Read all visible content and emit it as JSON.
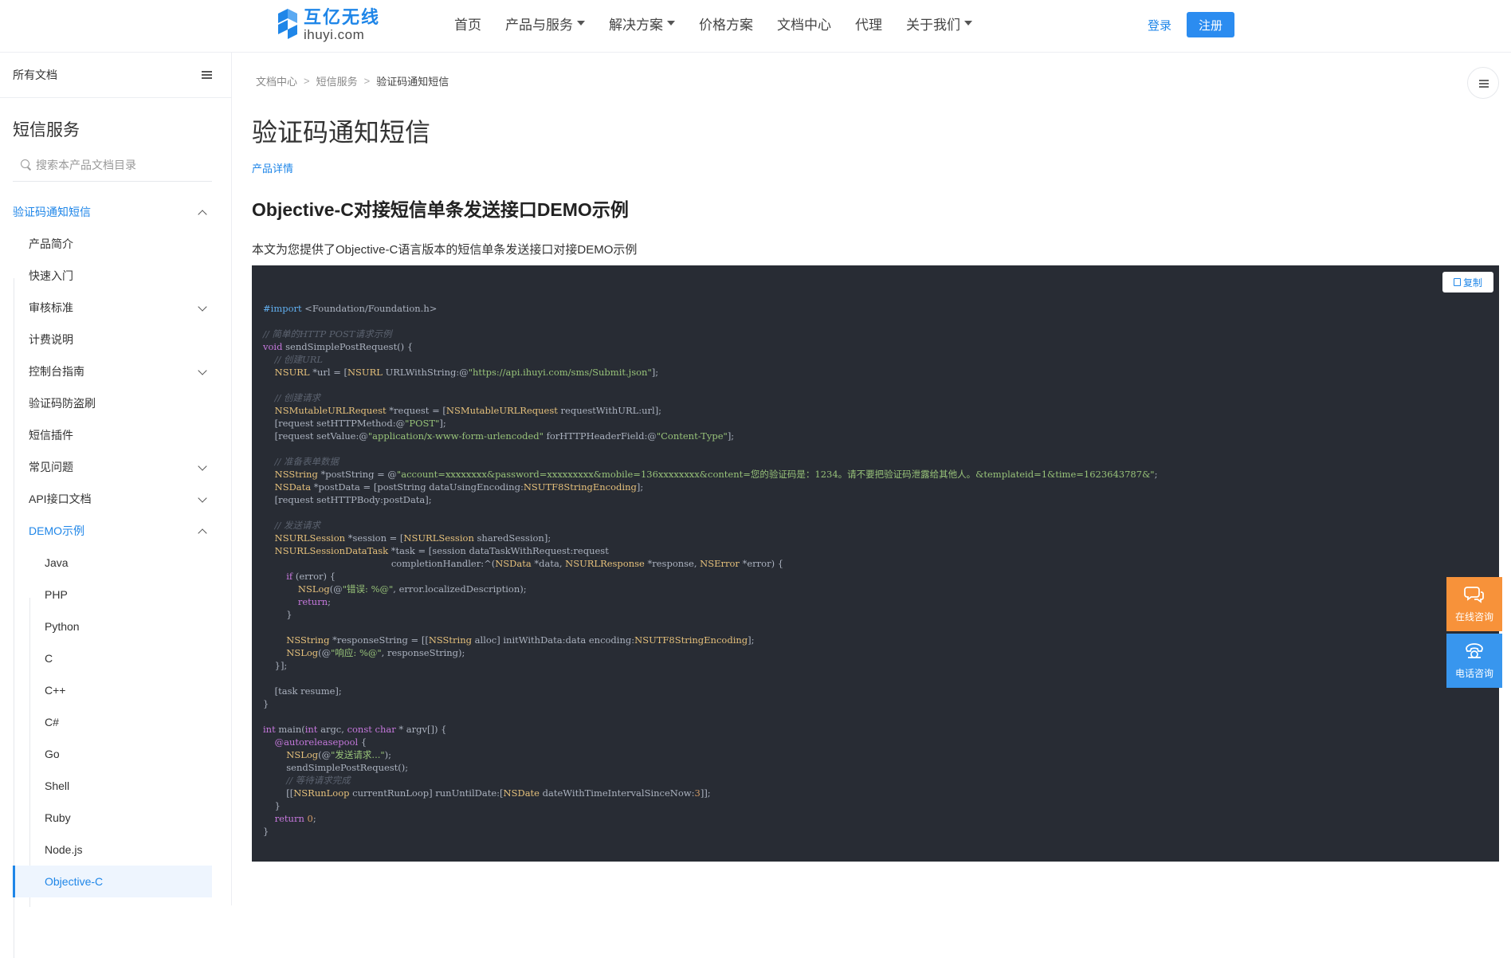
{
  "brand": {
    "name_cn": "互亿无线",
    "name_en": "ihuyi.com",
    "color": "#1f86e8"
  },
  "nav": {
    "items": [
      {
        "label": "首页",
        "dropdown": false
      },
      {
        "label": "产品与服务",
        "dropdown": true
      },
      {
        "label": "解决方案",
        "dropdown": true
      },
      {
        "label": "价格方案",
        "dropdown": false
      },
      {
        "label": "文档中心",
        "dropdown": false
      },
      {
        "label": "代理",
        "dropdown": false
      },
      {
        "label": "关于我们",
        "dropdown": true
      }
    ],
    "login": "登录",
    "register": "注册"
  },
  "sidebar": {
    "all_docs": "所有文档",
    "section_title": "短信服务",
    "search_placeholder": "搜索本产品文档目录",
    "tree": [
      {
        "label": "验证码通知短信",
        "level": 0,
        "expand": "up"
      },
      {
        "label": "产品简介",
        "level": 1
      },
      {
        "label": "快速入门",
        "level": 1
      },
      {
        "label": "审核标准",
        "level": 1,
        "expand": "down"
      },
      {
        "label": "计费说明",
        "level": 1
      },
      {
        "label": "控制台指南",
        "level": 1,
        "expand": "down"
      },
      {
        "label": "验证码防盗刷",
        "level": 1
      },
      {
        "label": "短信插件",
        "level": 1
      },
      {
        "label": "常见问题",
        "level": 1,
        "expand": "down"
      },
      {
        "label": "API接口文档",
        "level": 1,
        "expand": "down"
      },
      {
        "label": "DEMO示例",
        "level": 1,
        "expand": "up",
        "highlight": true
      },
      {
        "label": "Java",
        "level": 2
      },
      {
        "label": "PHP",
        "level": 2
      },
      {
        "label": "Python",
        "level": 2
      },
      {
        "label": "C",
        "level": 2
      },
      {
        "label": "C++",
        "level": 2
      },
      {
        "label": "C#",
        "level": 2
      },
      {
        "label": "Go",
        "level": 2
      },
      {
        "label": "Shell",
        "level": 2
      },
      {
        "label": "Ruby",
        "level": 2
      },
      {
        "label": "Node.js",
        "level": 2
      },
      {
        "label": "Objective-C",
        "level": 2,
        "active": true
      }
    ]
  },
  "breadcrumb": [
    "文档中心",
    "短信服务",
    "验证码通知短信"
  ],
  "page": {
    "title": "验证码通知短信",
    "product_link": "产品详情",
    "heading": "Objective-C对接短信单条发送接口DEMO示例",
    "description": "本文为您提供了Objective-C语言版本的短信单条发送接口对接DEMO示例"
  },
  "code": {
    "copy_label": "复制",
    "lines": [
      "#import <Foundation/Foundation.h>",
      "",
      "// 简单的HTTP POST请求示例",
      "void sendSimplePostRequest() {",
      "    // 创建URL",
      "    NSURL *url = [NSURL URLWithString:@\"https://api.ihuyi.com/sms/Submit.json\"];",
      "",
      "    // 创建请求",
      "    NSMutableURLRequest *request = [NSMutableURLRequest requestWithURL:url];",
      "    [request setHTTPMethod:@\"POST\"];",
      "    [request setValue:@\"application/x-www-form-urlencoded\" forHTTPHeaderField:@\"Content-Type\"];",
      "",
      "    // 准备表单数据",
      "    NSString *postString = @\"account=xxxxxxxx&password=xxxxxxxxx&mobile=136xxxxxxxx&content=您的验证码是：1234。请不要把验证码泄露给其他人。&templateid=1&time=1623643787&\";",
      "    NSData *postData = [postString dataUsingEncoding:NSUTF8StringEncoding];",
      "    [request setHTTPBody:postData];",
      "",
      "    // 发送请求",
      "    NSURLSession *session = [NSURLSession sharedSession];",
      "    NSURLSessionDataTask *task = [session dataTaskWithRequest:request",
      "                                            completionHandler:^(NSData *data, NSURLResponse *response, NSError *error) {",
      "        if (error) {",
      "            NSLog(@\"错误: %@\", error.localizedDescription);",
      "            return;",
      "        }",
      "",
      "        NSString *responseString = [[NSString alloc] initWithData:data encoding:NSUTF8StringEncoding];",
      "        NSLog(@\"响应: %@\", responseString);",
      "    }];",
      "",
      "    [task resume];",
      "}",
      "",
      "int main(int argc, const char * argv[]) {",
      "    @autoreleasepool {",
      "        NSLog(@\"发送请求...\");",
      "        sendSimplePostRequest();",
      "        // 等待请求完成",
      "        [[NSRunLoop currentRunLoop] runUntilDate:[NSDate dateWithTimeIntervalSinceNow:3]];",
      "    }",
      "    return 0;",
      "}"
    ]
  },
  "float": {
    "online": "在线咨询",
    "phone": "电话咨询",
    "online_color": "#f7923a",
    "phone_color": "#3896ee"
  }
}
